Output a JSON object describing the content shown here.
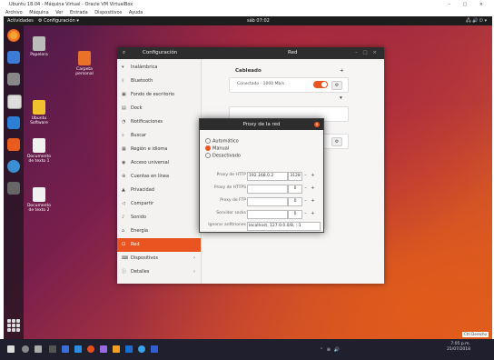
{
  "host": {
    "title": "Ubuntu 18.04 - Máquina Virtual - Oracle VM VirtualBox",
    "controls": "–  ▢  ×",
    "menu": [
      "Archivo",
      "Máquina",
      "Ver",
      "Entrada",
      "Dispositivos",
      "Ayuda"
    ]
  },
  "topbar": {
    "activities": "Actividades",
    "app_menu": "⚙ Configuración ▾",
    "clock": "sáb 07:02",
    "tray": "🖧 🔊 ⏻ ▾"
  },
  "desktop": {
    "icons": [
      {
        "label": "Papelera"
      },
      {
        "label": "Carpeta personal"
      },
      {
        "label": "Ubuntu Software"
      },
      {
        "label": "Documento de texto 1"
      },
      {
        "label": "Documento de texto 2"
      }
    ]
  },
  "settings": {
    "search_icon": "search-icon",
    "title_left": "Configuración",
    "title_right": "Red",
    "window_controls": "– ▢ ×",
    "sidebar": [
      {
        "label": "Inalámbrica",
        "icon": "▾"
      },
      {
        "label": "Bluetooth",
        "icon": "ᛒ"
      },
      {
        "label": "Fondo de escritorio",
        "icon": "▣"
      },
      {
        "label": "Dock",
        "icon": "▤"
      },
      {
        "label": "Notificaciones",
        "icon": "◔"
      },
      {
        "label": "Buscar",
        "icon": "⌕"
      },
      {
        "label": "Región e idioma",
        "icon": "▦"
      },
      {
        "label": "Acceso universal",
        "icon": "◉"
      },
      {
        "label": "Cuentas en línea",
        "icon": "⊕"
      },
      {
        "label": "Privacidad",
        "icon": "▲"
      },
      {
        "label": "Compartir",
        "icon": "◁"
      },
      {
        "label": "Sonido",
        "icon": "♪"
      },
      {
        "label": "Energía",
        "icon": "⌂"
      },
      {
        "label": "Red",
        "icon": "⊡",
        "active": true
      },
      {
        "label": "Dispositivos",
        "icon": "⌨",
        "arrow": "›"
      },
      {
        "label": "Detalles",
        "icon": "ⓘ",
        "arrow": "›"
      }
    ],
    "wired_header": "Cableado",
    "wired_status": "Conectado - 1000 Mb/s",
    "add_symbol": "+",
    "gear_symbol": "⚙"
  },
  "proxy": {
    "title": "Proxy de la red",
    "close": "×",
    "modes": [
      {
        "label": "Automático",
        "selected": false
      },
      {
        "label": "Manual",
        "selected": true
      },
      {
        "label": "Desactivado",
        "selected": false
      }
    ],
    "rows": [
      {
        "label": "Proxy de HTTP",
        "value": "192.168.0.2",
        "port": "3128"
      },
      {
        "label": "Proxy de HTTPS",
        "value": "",
        "port": "0"
      },
      {
        "label": "Proxy de FTP",
        "value": "",
        "port": "0"
      },
      {
        "label": "Servidor socks",
        "value": "",
        "port": "0"
      }
    ],
    "ignore_label": "Ignorar anfitriones",
    "ignore_value": "localhost, 127.0.0.0/8, ::1",
    "minus": "–",
    "plus": "+"
  },
  "taskbar": {
    "tray_time": "7:05 p.m.",
    "tray_date": "21/07/2018",
    "tray_icons": "⌃ ⊕ 🔊"
  },
  "vbox_status": "Ctrl Derecho"
}
